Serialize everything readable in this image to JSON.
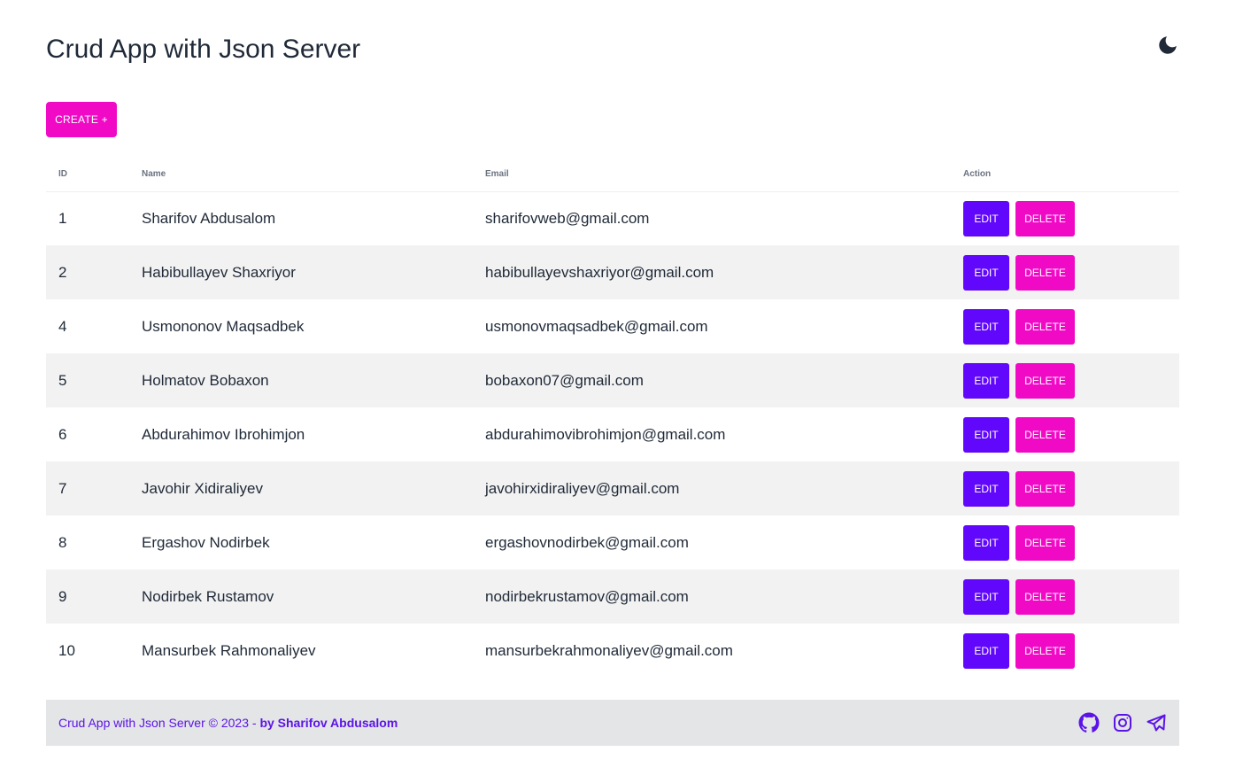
{
  "header": {
    "title": "Crud App with Json Server",
    "theme_icon": "moon-icon"
  },
  "toolbar": {
    "create_label": "CREATE +"
  },
  "table": {
    "columns": [
      "ID",
      "Name",
      "Email",
      "Action"
    ],
    "edit_label": "EDIT",
    "delete_label": "DELETE",
    "rows": [
      {
        "id": "1",
        "name": "Sharifov Abdusalom",
        "email": "sharifovweb@gmail.com"
      },
      {
        "id": "2",
        "name": "Habibullayev Shaxriyor",
        "email": "habibullayevshaxriyor@gmail.com"
      },
      {
        "id": "4",
        "name": "Usmononov Maqsadbek",
        "email": "usmonovmaqsadbek@gmail.com"
      },
      {
        "id": "5",
        "name": "Holmatov Bobaxon",
        "email": "bobaxon07@gmail.com"
      },
      {
        "id": "6",
        "name": "Abdurahimov Ibrohimjon",
        "email": "abdurahimovibrohimjon@gmail.com"
      },
      {
        "id": "7",
        "name": "Javohir Xidiraliyev",
        "email": "javohirxidiraliyev@gmail.com"
      },
      {
        "id": "8",
        "name": "Ergashov Nodirbek",
        "email": "ergashovnodirbek@gmail.com"
      },
      {
        "id": "9",
        "name": "Nodirbek Rustamov",
        "email": "nodirbekrustamov@gmail.com"
      },
      {
        "id": "10",
        "name": "Mansurbek Rahmonaliyev",
        "email": "mansurbekrahmonaliyev@gmail.com"
      }
    ]
  },
  "footer": {
    "text": "Crud App with Json Server © 2023 - ",
    "author": "by Sharifov Abdusalom",
    "icons": [
      "github-icon",
      "instagram-icon",
      "telegram-icon"
    ]
  },
  "colors": {
    "primary_pink": "#f00ac6",
    "primary_violet": "#6107fb",
    "footer_bg": "#e4e5e6",
    "footer_text": "#5b14e8",
    "stripe": "#f2f2f2"
  }
}
